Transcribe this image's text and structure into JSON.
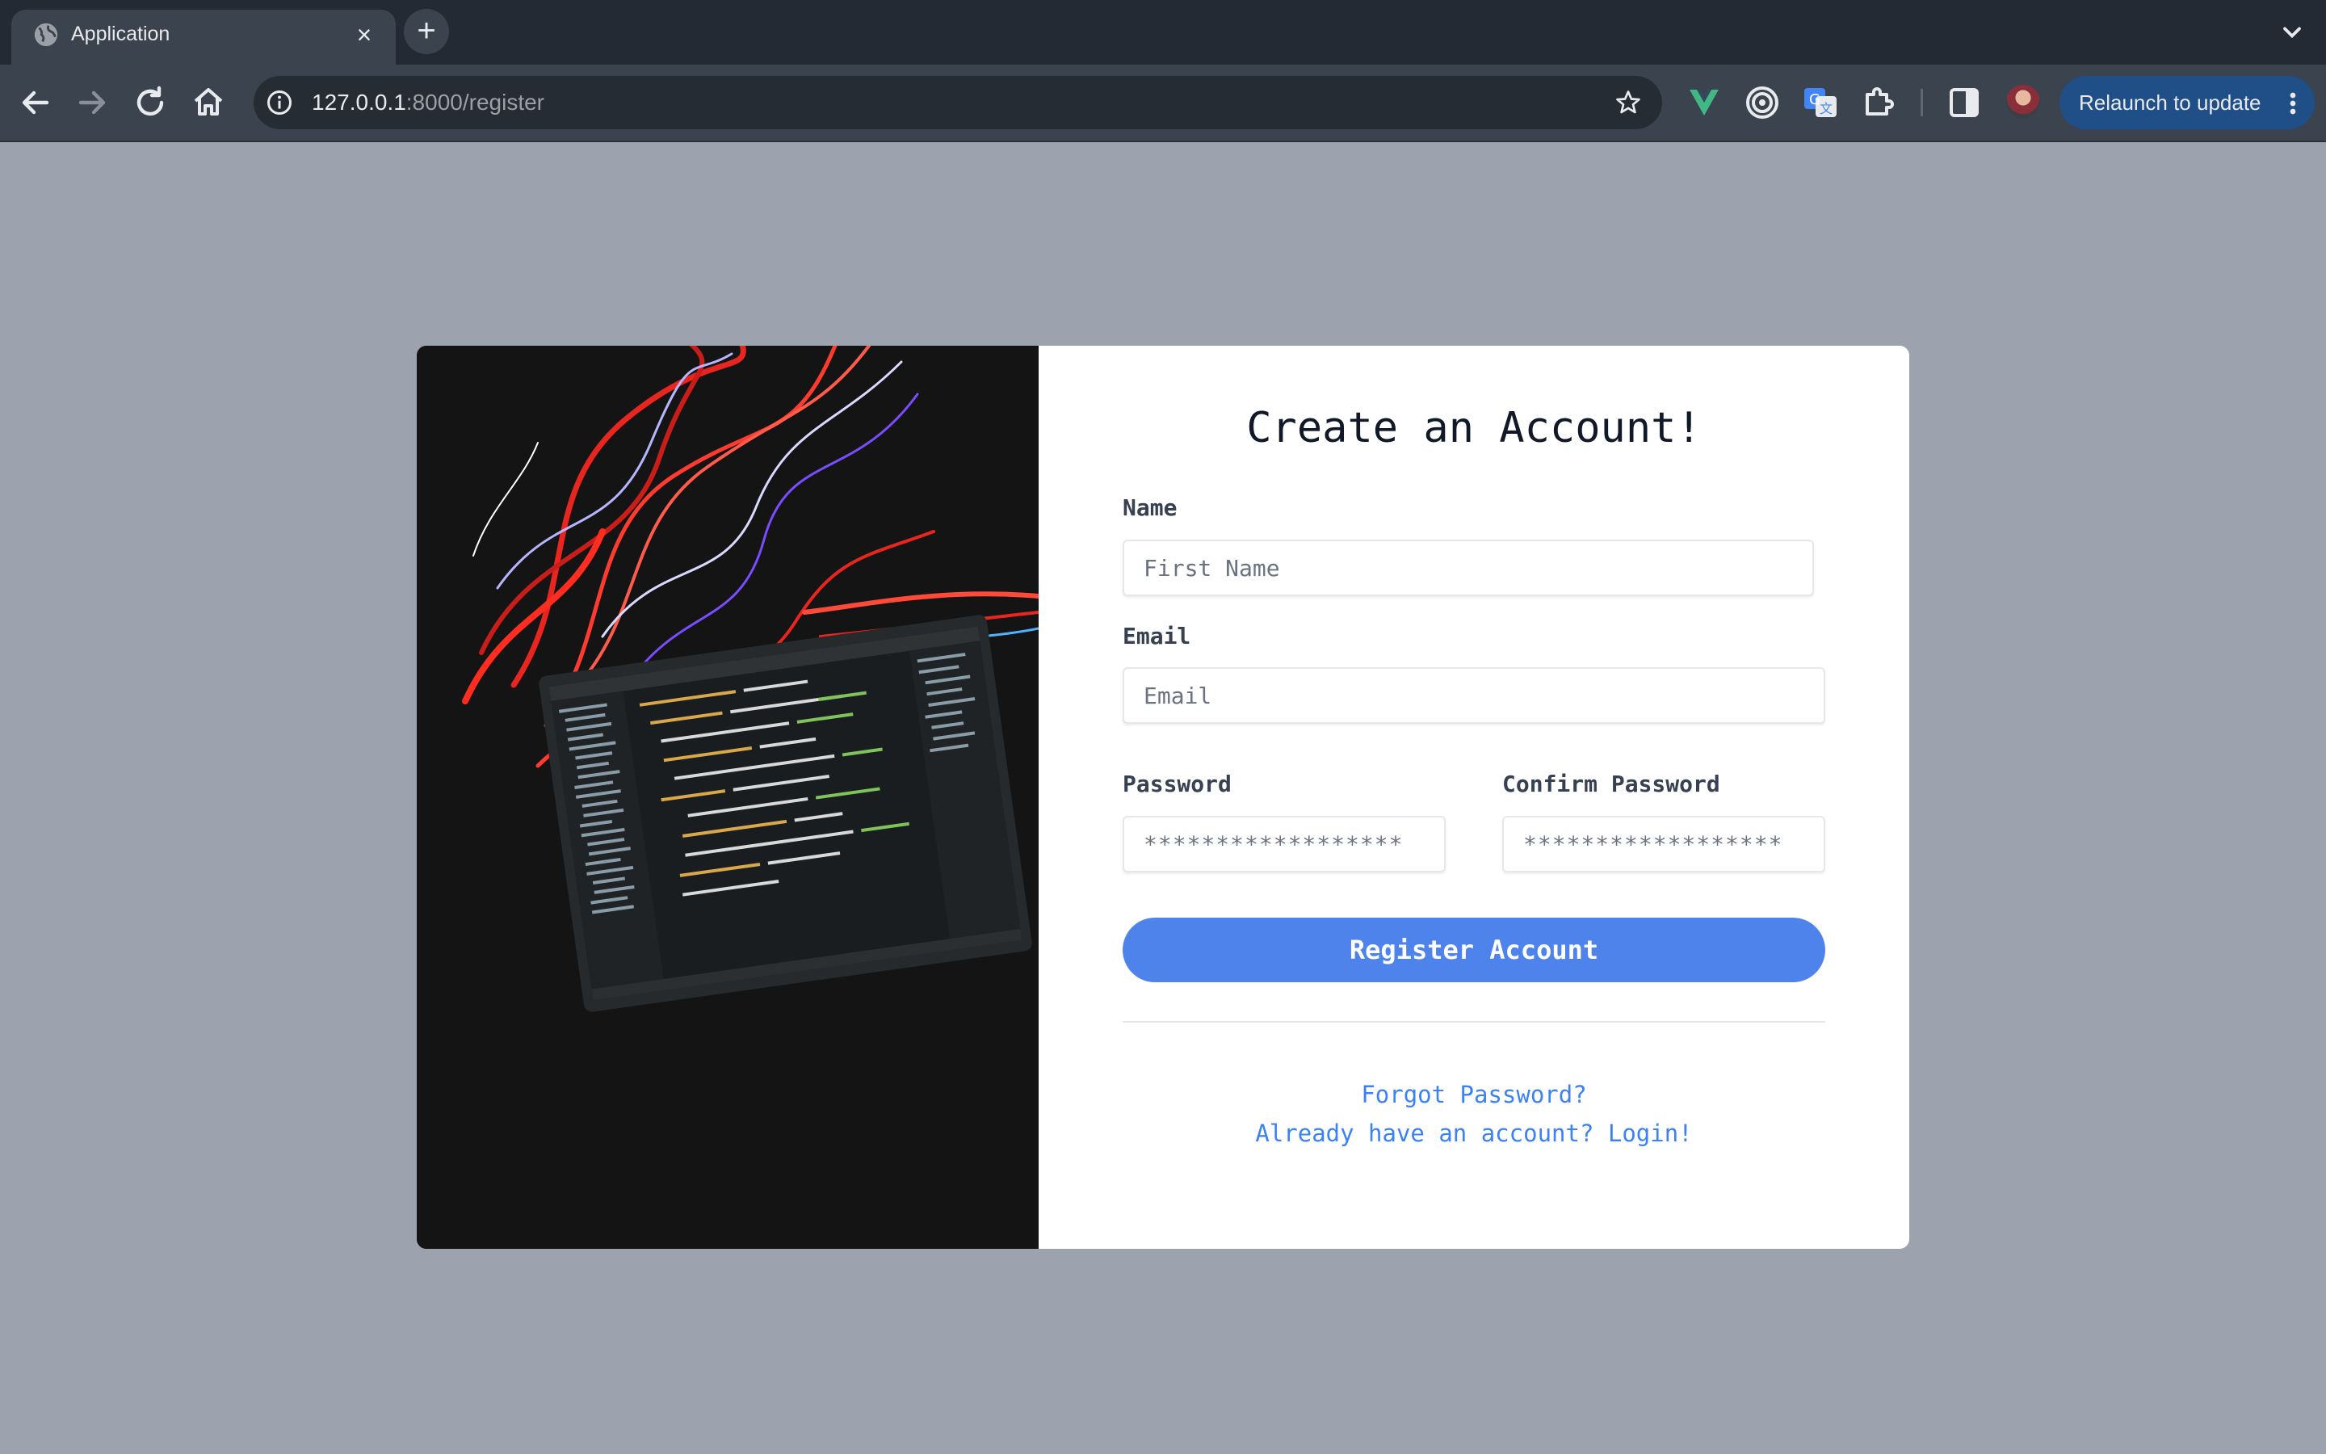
{
  "browser": {
    "tab": {
      "title": "Application",
      "favicon": "globe-icon"
    },
    "omnibox": {
      "host": "127.0.0.1",
      "path": ":8000/register"
    },
    "relaunch_label": "Relaunch to update",
    "colors": {
      "tabstrip": "#232a33",
      "toolbar": "#3b434e",
      "relaunch": "#1f4f86"
    }
  },
  "form": {
    "heading": "Create an Account!",
    "name": {
      "label": "Name",
      "placeholder": "First Name",
      "value": ""
    },
    "email": {
      "label": "Email",
      "placeholder": "Email",
      "value": ""
    },
    "password": {
      "label": "Password",
      "placeholder": "******************",
      "value": ""
    },
    "confirm_password": {
      "label": "Confirm Password",
      "placeholder": "******************",
      "value": ""
    },
    "submit_label": "Register Account",
    "forgot_link": "Forgot Password?",
    "login_link": "Already have an account? Login!"
  },
  "colors": {
    "background": "#9ca3af",
    "accent": "#4f83ec",
    "link": "#3b82f6"
  }
}
